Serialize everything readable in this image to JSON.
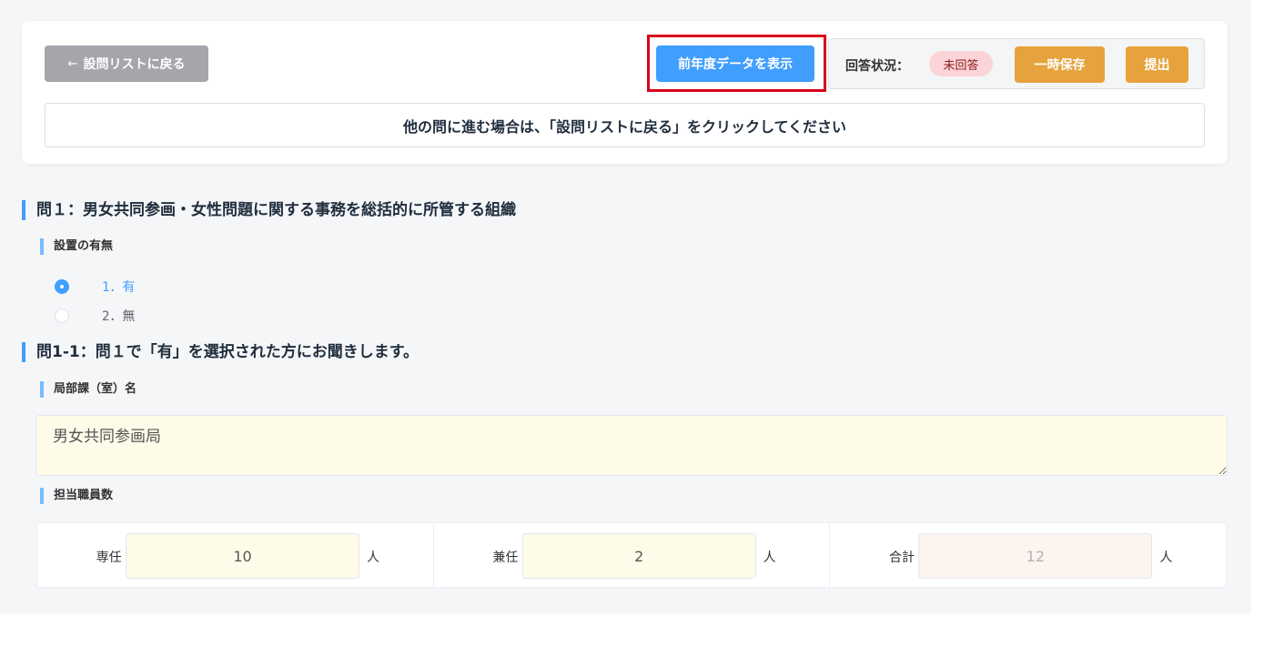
{
  "header": {
    "back_label": "設問リストに戻る",
    "back_arrow": "←",
    "prev_year_label": "前年度データを表示",
    "status_label": "回答状況：",
    "status_value": "未回答",
    "save_label": "一時保存",
    "submit_label": "提出",
    "notice": "他の問に進む場合は、「設問リストに戻る」をクリックしてください"
  },
  "q1": {
    "title": "問１：男女共同参画・女性問題に関する事務を総括的に所管する組織",
    "sub_title": "設置の有無",
    "options": [
      {
        "label": "1．有",
        "checked": true
      },
      {
        "label": "2．無",
        "checked": false
      }
    ]
  },
  "q1_1": {
    "title": "問1-1：問１で「有」を選択された方にお聞きします。",
    "dept_label": "局部課（室）名",
    "dept_value": "男女共同参画局",
    "staff_label": "担当職員数",
    "staff": [
      {
        "label": "専任",
        "value": "10",
        "unit": "人"
      },
      {
        "label": "兼任",
        "value": "2",
        "unit": "人"
      },
      {
        "label": "合計",
        "value": "12",
        "unit": "人"
      }
    ]
  },
  "colors": {
    "primary": "#409eff",
    "warning": "#e6a23c",
    "highlight": "#d9001b",
    "status_badge_bg": "#fbd4d8"
  }
}
